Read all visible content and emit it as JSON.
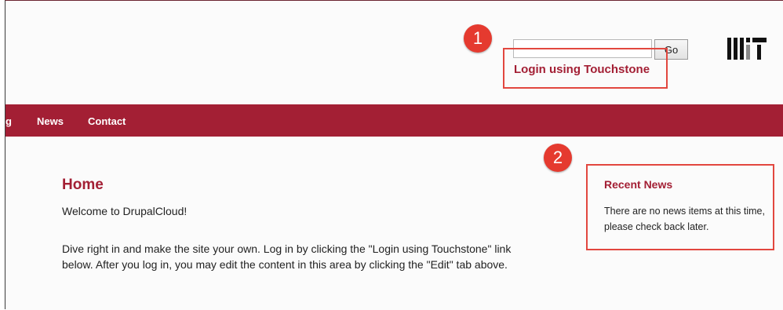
{
  "header": {
    "search_value": "",
    "search_button_label": "Go",
    "login_link_label": "Login using Touchstone"
  },
  "navbar": {
    "items": [
      {
        "label": "g"
      },
      {
        "label": "News"
      },
      {
        "label": "Contact"
      }
    ]
  },
  "main": {
    "title": "Home",
    "welcome_text": "Welcome to DrupalCloud!",
    "intro_text": "Dive right in and make the site your own. Log in by clicking the \"Login using Touchstone\" link below. After you log in, you may edit the content in this area by clicking the \"Edit\" tab above."
  },
  "sidebar": {
    "recent_news_title": "Recent News",
    "recent_news_text": "There are no news items at this time, please check back later."
  },
  "annotations": {
    "badges": [
      "1",
      "2"
    ]
  },
  "colors": {
    "brand_red": "#a31f34",
    "annotation_red": "#e53a2f"
  },
  "icons": {
    "logo": "mit-logo-icon"
  }
}
